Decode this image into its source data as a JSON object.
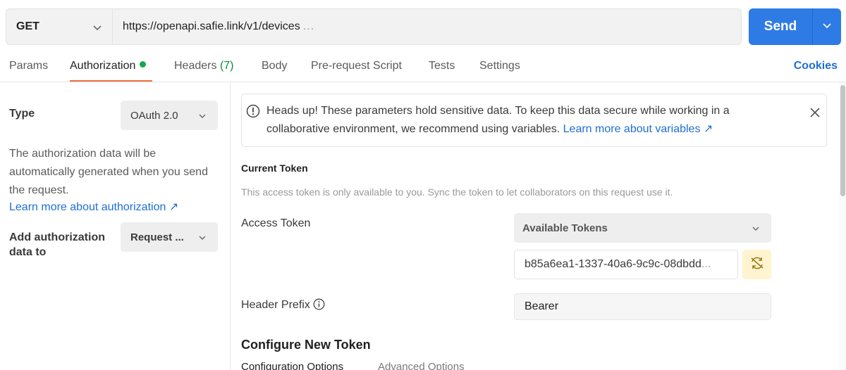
{
  "request": {
    "method": "GET",
    "url": "https://openapi.safie.link/v1/devices",
    "url_overflow": "...",
    "send_label": "Send"
  },
  "tabs": [
    {
      "label": "Params"
    },
    {
      "label": "Authorization"
    },
    {
      "label": "Headers",
      "count": "(7)"
    },
    {
      "label": "Body"
    },
    {
      "label": "Pre-request Script"
    },
    {
      "label": "Tests"
    },
    {
      "label": "Settings"
    }
  ],
  "cookies_label": "Cookies",
  "left": {
    "type_label": "Type",
    "type_value": "OAuth 2.0",
    "description": "The authorization data will be automatically generated when you send the request.",
    "learn_more": "Learn more about authorization ↗",
    "add_to_label": "Add authorization data to",
    "add_to_value": "Request ..."
  },
  "alert": {
    "text": "Heads up! These parameters hold sensitive data. To keep this data secure while working in a collaborative environment, we recommend using variables.",
    "link": "Learn more about variables ↗"
  },
  "current_token": {
    "title": "Current Token",
    "note": "This access token is only available to you. Sync the token to let collaborators on this request use it.",
    "access_token_label": "Access Token",
    "available_tokens": "Available Tokens",
    "token_value": "b85a6ea1-1337-40a6-9c9c-08dbdd",
    "token_overflow": "...",
    "header_prefix_label": "Header Prefix",
    "header_prefix_value": "Bearer"
  },
  "configure": {
    "title": "Configure New Token",
    "subtabs": [
      "Configuration Options",
      "Advanced Options"
    ]
  },
  "colors": {
    "accent": "#2f7be6",
    "active_tab_underline": "#f26b3a",
    "auth_dot": "#14a84a",
    "link": "#1f6fd1",
    "sync_button_bg": "#fff4cf"
  },
  "icons": [
    "chevron-down-icon",
    "info-circle-icon",
    "close-icon",
    "sync-off-icon"
  ]
}
